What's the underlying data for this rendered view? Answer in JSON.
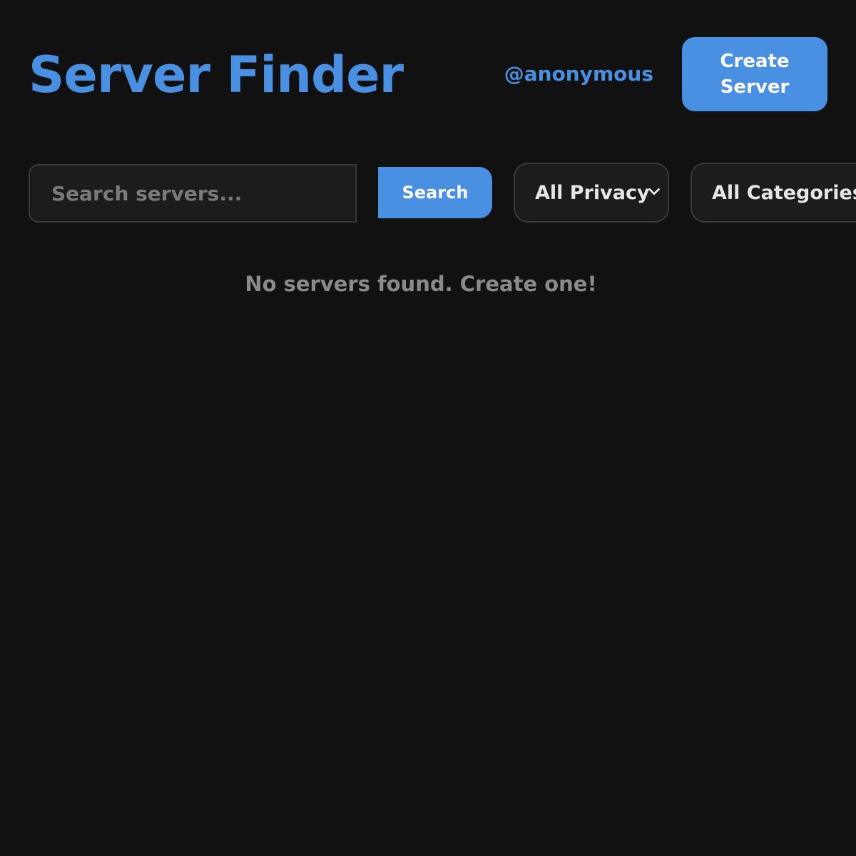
{
  "header": {
    "title": "Server Finder",
    "username": "@anonymous",
    "create_button_label": "Create Server"
  },
  "search": {
    "placeholder": "Search servers...",
    "value": "",
    "button_label": "Search"
  },
  "filters": {
    "privacy": {
      "selected": "All Privacy",
      "icon": "chevron-down-icon"
    },
    "category": {
      "selected": "All Categories"
    }
  },
  "results": {
    "empty_message": "No servers found. Create one!"
  },
  "colors": {
    "background": "#111111",
    "accent": "#4a90e2",
    "control_background": "#1c1c1c",
    "control_border": "#3a3a3a",
    "muted_text": "#8a8a8a"
  }
}
